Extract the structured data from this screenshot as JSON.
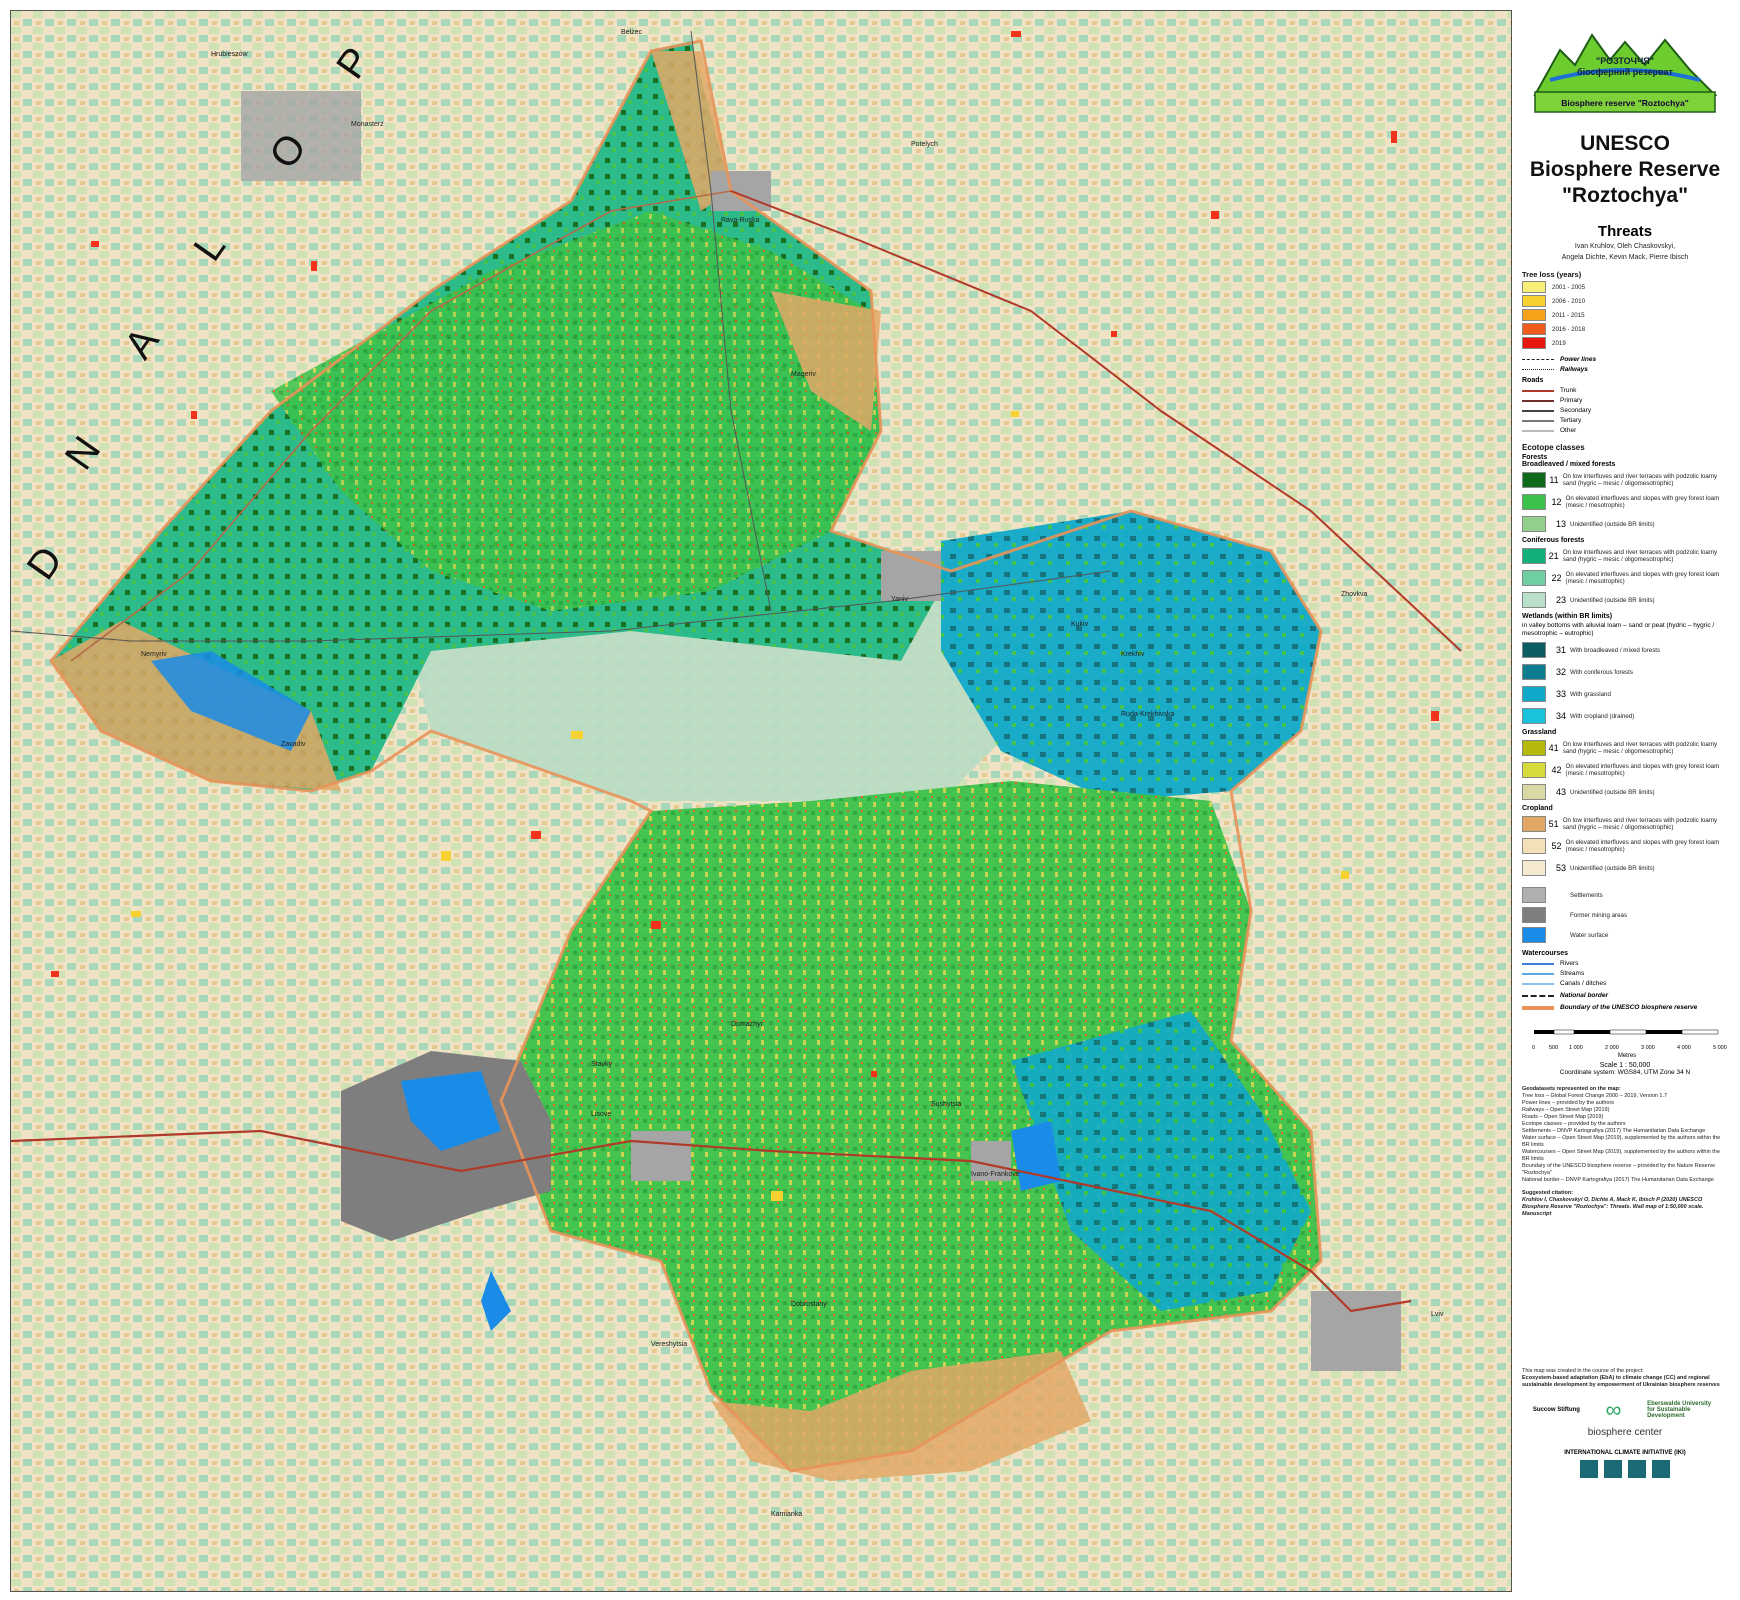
{
  "map": {
    "country_label_letters": [
      "P",
      "O",
      "L",
      "A",
      "N",
      "D"
    ],
    "colors": {
      "cropland_low": "#e3a866",
      "cropland_mid": "#f3dfb8",
      "forest_broadleaved": "#3cc24a",
      "forest_dark": "#0e6a1b",
      "coniferous": "#24b988",
      "coniferous_light": "#9dd4b7",
      "wetland": "#0aa7c4",
      "wetland_dark": "#0b6e7d",
      "water": "#1a8be6",
      "settlement": "#a5a5a5",
      "mining": "#7e7e7e",
      "grassland_outside": "#cfd8a5",
      "tree_loss": "#f2321b",
      "trunk_road": "#b03a2a"
    },
    "place_labels": [
      "Hrubieszów",
      "Monasterz",
      "Bełżec",
      "Rava-Ruska",
      "Potelych",
      "Mageriv",
      "Zhovkva",
      "Krekhiv",
      "Lviv",
      "Yaniv",
      "Ivano-Frankove",
      "Dobrostany",
      "Zavadiv",
      "Kamianka",
      "Ruda-Krekhivska",
      "Stavky",
      "Lisove",
      "Nemyriv",
      "Vereshytsia",
      "Domazhyr",
      "Kukiv",
      "Sushytsia"
    ]
  },
  "legend": {
    "logo_line1": "\"РОЗТОЧЧЯ\"",
    "logo_line2": "біосферний резерват",
    "logo_line3": "Biosphere reserve \"Roztochya\"",
    "title_line1": "UNESCO",
    "title_line2": "Biosphere Reserve",
    "title_line3": "\"Roztochya\"",
    "subtitle": "Threats",
    "authors_line1": "Ivan Kruhlov, Oleh Chaskovskyi,",
    "authors_line2": "Angela Dichte, Kevin Mack, Pierre Ibisch",
    "tree_loss_title": "Tree loss (years)",
    "tree_loss": [
      {
        "label": "2001 - 2005",
        "color": "#f7ef78"
      },
      {
        "label": "2006 - 2010",
        "color": "#f6d12f"
      },
      {
        "label": "2011 - 2015",
        "color": "#f7a21b"
      },
      {
        "label": "2016 - 2018",
        "color": "#f05a1a"
      },
      {
        "label": "2019",
        "color": "#e8150f"
      }
    ],
    "power_lines": "Power lines",
    "railways": "Railways",
    "roads_title": "Roads",
    "roads": [
      {
        "label": "Trunk",
        "color": "#b03a2a"
      },
      {
        "label": "Primary",
        "color": "#6e2f2a"
      },
      {
        "label": "Secondary",
        "color": "#444444"
      },
      {
        "label": "Tertiary",
        "color": "#777777"
      },
      {
        "label": "Other",
        "color": "#bbbbbb"
      }
    ],
    "ecotope_title": "Ecotope classes",
    "forests_title": "Forests",
    "broadleaved_title": "Broadleaved / mixed forests",
    "broadleaved": [
      {
        "code": "11",
        "color": "#0e6a1b",
        "desc": "On low interfluves and river terraces with podzolic loamy sand (hygric – mesic / oligomesotrophic)"
      },
      {
        "code": "12",
        "color": "#3cc24a",
        "desc": "On elevated interfluves and slopes with grey forest loam (mesic / mesotrophic)"
      },
      {
        "code": "13",
        "color": "#93cf8c",
        "desc": "Unidentified (outside BR limits)"
      }
    ],
    "coniferous_title": "Coniferous forests",
    "coniferous": [
      {
        "code": "21",
        "color": "#13b07c",
        "desc": "On low interfluves and river terraces with podzolic loamy sand (hygric – mesic / oligomesotrophic)"
      },
      {
        "code": "22",
        "color": "#6fcfa2",
        "desc": "On elevated interfluves and slopes with grey forest loam (mesic / mesotrophic)"
      },
      {
        "code": "23",
        "color": "#b9e0cb",
        "desc": "Unidentified (outside BR limits)"
      }
    ],
    "wetlands_title": "Wetlands (within BR limits)",
    "wetlands_note": "in valley bottoms with alluvial loam – sand or peat (hydric – hygric / mesotrophic – eutrophic)",
    "wetlands": [
      {
        "code": "31",
        "color": "#0b5b63",
        "desc": "With broadleaved / mixed forests"
      },
      {
        "code": "32",
        "color": "#0b7d8f",
        "desc": "With coniferous forests"
      },
      {
        "code": "33",
        "color": "#10a9c9",
        "desc": "With grassland"
      },
      {
        "code": "34",
        "color": "#19c3dc",
        "desc": "With cropland (drained)"
      }
    ],
    "grassland_title": "Grassland",
    "grassland": [
      {
        "code": "41",
        "color": "#b5b90f",
        "desc": "On low interfluves and river terraces with podzolic loamy sand (hygric – mesic / oligomesotrophic)"
      },
      {
        "code": "42",
        "color": "#d6da3c",
        "desc": "On elevated interfluves and slopes with grey forest loam (mesic / mesotrophic)"
      },
      {
        "code": "43",
        "color": "#d9d9a4",
        "desc": "Unidentified (outside BR limits)"
      }
    ],
    "cropland_title": "Cropland",
    "cropland": [
      {
        "code": "51",
        "color": "#e3a866",
        "desc": "On low interfluves and river terraces with podzolic loamy sand (hygric – mesic / oligomesotrophic)"
      },
      {
        "code": "52",
        "color": "#f3dfb8",
        "desc": "On elevated interfluves and slopes with grey forest loam (mesic / mesotrophic)"
      },
      {
        "code": "53",
        "color": "#f5e9d2",
        "desc": "Unidentified (outside BR limits)"
      }
    ],
    "other": [
      {
        "label": "Settlements",
        "color": "#b0b0b0"
      },
      {
        "label": "Former mining areas",
        "color": "#7e7e7e"
      },
      {
        "label": "Water surface",
        "color": "#1a8be6"
      }
    ],
    "watercourses_title": "Watercourses",
    "watercourses": [
      {
        "label": "Rivers",
        "color": "#3b7fd8"
      },
      {
        "label": "Streams",
        "color": "#5aa7e6"
      },
      {
        "label": "Canals / ditches",
        "color": "#8fc1ee"
      }
    ],
    "national_border": "National border",
    "boundary": "Boundary of the UNESCO biosphere reserve",
    "scale_ticks": [
      "0",
      "500",
      "1 000",
      "2 000",
      "3 000",
      "4 000",
      "5 000"
    ],
    "scale_unit": "Metres",
    "scale_text": "Scale 1 : 50,000",
    "coord_system": "Coordinate system: WGS84, UTM Zone 34 N",
    "datasets_title": "Geodatasets represented on the map:",
    "datasets": [
      "Tree loss – Global Forest Change 2000 – 2019, Version 1.7",
      "Power lines – provided by the authors",
      "Railways – Open Street Map (2019)",
      "Roads – Open Street Map (2019)",
      "Ecotope classes – provided by the authors",
      "Settlements – DNVP Kartografiya (2017) The Humanitarian Data Exchange",
      "Water surface – Open Street Map (2019), supplemented by the authors within the BR limits",
      "Watercourses – Open Street Map (2019), supplemented by the authors within the BR limits",
      "Boundary of the UNESCO biosphere reserve – provided by the Nature Reserve \"Roztochya\"",
      "National border – DNVP Kartografiya (2017) The Humanitarian Data Exchange"
    ],
    "citation_title": "Suggested citation:",
    "citation": "Kruhlov I, Chaskovskyi O, Dichte A, Mack K, Ibisch P (2020) UNESCO Biosphere Reserve \"Roztochya\": Threats. Wall map of 1:50,000 scale. Manuscript",
    "project_note": "This map was created in the course of the project:",
    "project_name": "Ecosystem-based adaptation (EbA) to climate change (CC) and regional sustainable development by empowerment of Ukrainian biosphere reserves",
    "partner1": "Succow Stiftung",
    "partner2": "Eberswalde University for Sustainable Development",
    "partner3": "biosphere center",
    "partner4": "INTERNATIONAL CLIMATE INITIATIVE (IKI)"
  }
}
